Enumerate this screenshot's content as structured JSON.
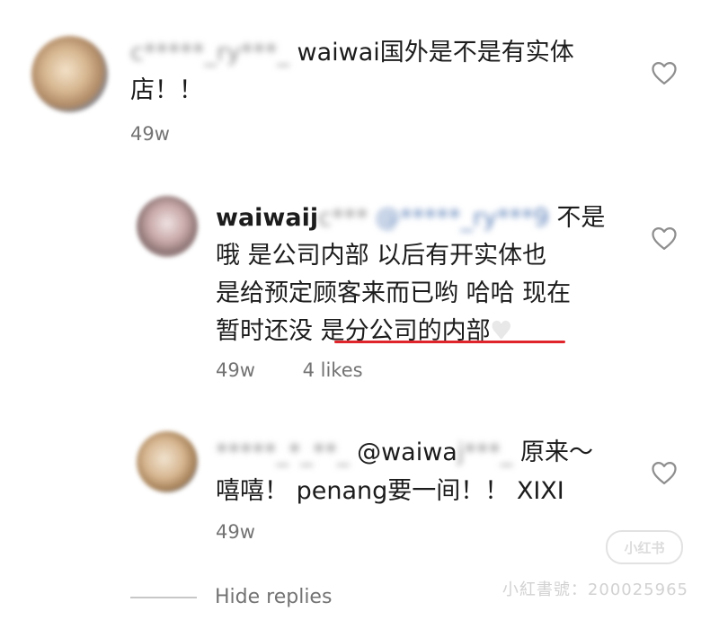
{
  "comments": [
    {
      "username": "c*****_ry***_",
      "line1": "waiwai国外是不是有实体",
      "line2": "店！！",
      "time": "49w"
    },
    {
      "username": "waiwaij",
      "username_blur": "c***",
      "mention_blur": "@*****_ry***9",
      "line1_tail": "不是",
      "line2": "哦 是公司内部  以后有开实体也",
      "line3": "是给预定顾客来而已哟 哈哈 现在",
      "line4_start": "暂时还没",
      "line4_highlight": "是分公司的内部",
      "time": "49w",
      "likes": "4 likes"
    },
    {
      "username": "*****_*_**_",
      "mention": "@waiwa",
      "mention_blur": "j***_",
      "line1_tail": "原来～",
      "line2": "嘻嘻！ penang要一间！！ XIXI",
      "time": "49w"
    }
  ],
  "hide_replies": "Hide replies",
  "watermark": {
    "logo": "小红书",
    "text": "小紅書號：200025965"
  },
  "colors": {
    "highlight_underline": "#e0242b",
    "meta_text": "#737373",
    "heart_stroke": "#8e8e8e"
  },
  "icons": {
    "like": "heart-outline-icon",
    "emoji": "white-heart-emoji"
  }
}
